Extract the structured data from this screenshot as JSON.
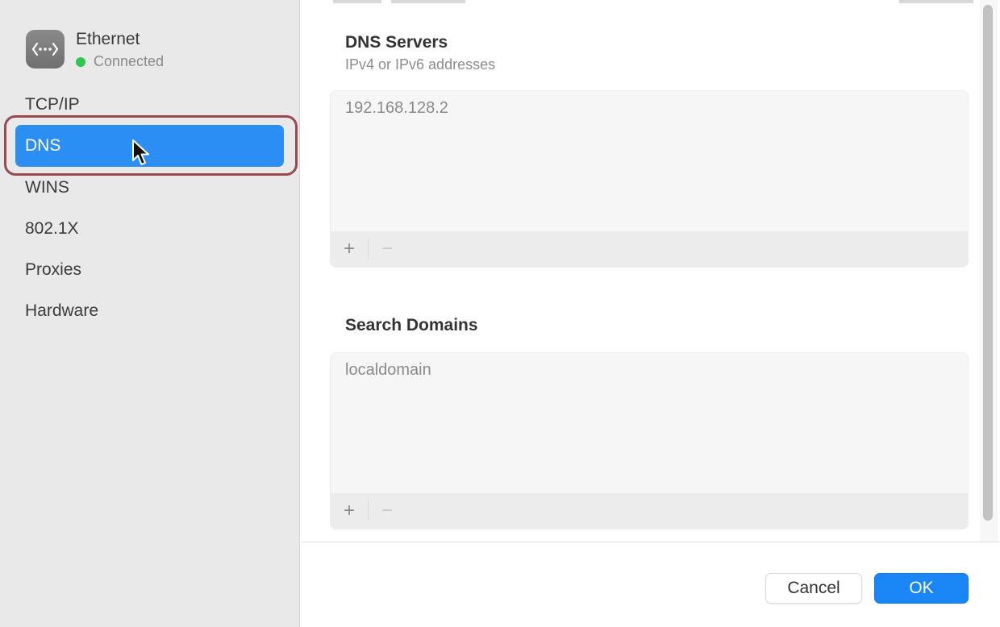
{
  "interface": {
    "name": "Ethernet",
    "status": "Connected",
    "status_color": "#2fc84f",
    "icon": "network-ethernet-icon"
  },
  "sidebar": {
    "selected_color": "#2b8ef3",
    "items": [
      {
        "label": "TCP/IP",
        "selected": false
      },
      {
        "label": "DNS",
        "selected": true
      },
      {
        "label": "WINS",
        "selected": false
      },
      {
        "label": "802.1X",
        "selected": false
      },
      {
        "label": "Proxies",
        "selected": false
      },
      {
        "label": "Hardware",
        "selected": false
      }
    ]
  },
  "dns_servers": {
    "title": "DNS Servers",
    "subtitle": "IPv4 or IPv6 addresses",
    "entries": [
      "192.168.128.2"
    ],
    "add_label": "+",
    "remove_label": "−"
  },
  "search_domains": {
    "title": "Search Domains",
    "entries": [
      "localdomain"
    ],
    "add_label": "+",
    "remove_label": "−"
  },
  "buttons": {
    "cancel": "Cancel",
    "ok": "OK",
    "ok_color": "#1a86f5"
  }
}
